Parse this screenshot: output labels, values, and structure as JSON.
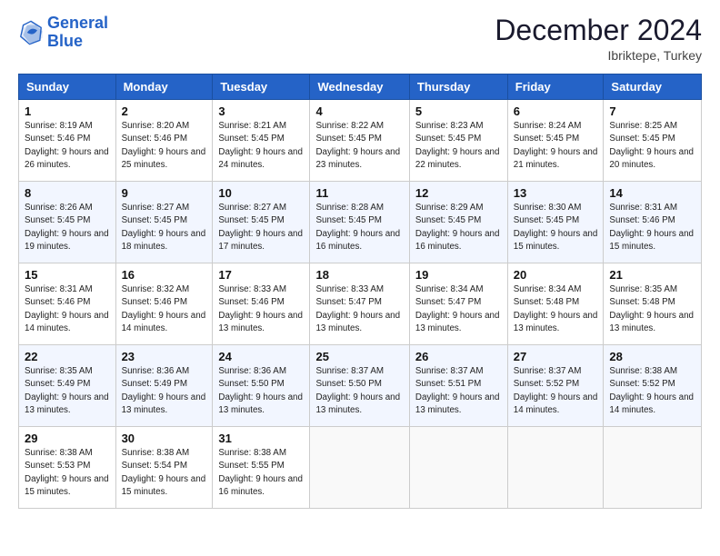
{
  "logo": {
    "line1": "General",
    "line2": "Blue"
  },
  "title": "December 2024",
  "location": "Ibriktepe, Turkey",
  "days_header": [
    "Sunday",
    "Monday",
    "Tuesday",
    "Wednesday",
    "Thursday",
    "Friday",
    "Saturday"
  ],
  "weeks": [
    [
      {
        "day": "1",
        "sunrise": "8:19 AM",
        "sunset": "5:46 PM",
        "daylight": "9 hours and 26 minutes."
      },
      {
        "day": "2",
        "sunrise": "8:20 AM",
        "sunset": "5:46 PM",
        "daylight": "9 hours and 25 minutes."
      },
      {
        "day": "3",
        "sunrise": "8:21 AM",
        "sunset": "5:45 PM",
        "daylight": "9 hours and 24 minutes."
      },
      {
        "day": "4",
        "sunrise": "8:22 AM",
        "sunset": "5:45 PM",
        "daylight": "9 hours and 23 minutes."
      },
      {
        "day": "5",
        "sunrise": "8:23 AM",
        "sunset": "5:45 PM",
        "daylight": "9 hours and 22 minutes."
      },
      {
        "day": "6",
        "sunrise": "8:24 AM",
        "sunset": "5:45 PM",
        "daylight": "9 hours and 21 minutes."
      },
      {
        "day": "7",
        "sunrise": "8:25 AM",
        "sunset": "5:45 PM",
        "daylight": "9 hours and 20 minutes."
      }
    ],
    [
      {
        "day": "8",
        "sunrise": "8:26 AM",
        "sunset": "5:45 PM",
        "daylight": "9 hours and 19 minutes."
      },
      {
        "day": "9",
        "sunrise": "8:27 AM",
        "sunset": "5:45 PM",
        "daylight": "9 hours and 18 minutes."
      },
      {
        "day": "10",
        "sunrise": "8:27 AM",
        "sunset": "5:45 PM",
        "daylight": "9 hours and 17 minutes."
      },
      {
        "day": "11",
        "sunrise": "8:28 AM",
        "sunset": "5:45 PM",
        "daylight": "9 hours and 16 minutes."
      },
      {
        "day": "12",
        "sunrise": "8:29 AM",
        "sunset": "5:45 PM",
        "daylight": "9 hours and 16 minutes."
      },
      {
        "day": "13",
        "sunrise": "8:30 AM",
        "sunset": "5:45 PM",
        "daylight": "9 hours and 15 minutes."
      },
      {
        "day": "14",
        "sunrise": "8:31 AM",
        "sunset": "5:46 PM",
        "daylight": "9 hours and 15 minutes."
      }
    ],
    [
      {
        "day": "15",
        "sunrise": "8:31 AM",
        "sunset": "5:46 PM",
        "daylight": "9 hours and 14 minutes."
      },
      {
        "day": "16",
        "sunrise": "8:32 AM",
        "sunset": "5:46 PM",
        "daylight": "9 hours and 14 minutes."
      },
      {
        "day": "17",
        "sunrise": "8:33 AM",
        "sunset": "5:46 PM",
        "daylight": "9 hours and 13 minutes."
      },
      {
        "day": "18",
        "sunrise": "8:33 AM",
        "sunset": "5:47 PM",
        "daylight": "9 hours and 13 minutes."
      },
      {
        "day": "19",
        "sunrise": "8:34 AM",
        "sunset": "5:47 PM",
        "daylight": "9 hours and 13 minutes."
      },
      {
        "day": "20",
        "sunrise": "8:34 AM",
        "sunset": "5:48 PM",
        "daylight": "9 hours and 13 minutes."
      },
      {
        "day": "21",
        "sunrise": "8:35 AM",
        "sunset": "5:48 PM",
        "daylight": "9 hours and 13 minutes."
      }
    ],
    [
      {
        "day": "22",
        "sunrise": "8:35 AM",
        "sunset": "5:49 PM",
        "daylight": "9 hours and 13 minutes."
      },
      {
        "day": "23",
        "sunrise": "8:36 AM",
        "sunset": "5:49 PM",
        "daylight": "9 hours and 13 minutes."
      },
      {
        "day": "24",
        "sunrise": "8:36 AM",
        "sunset": "5:50 PM",
        "daylight": "9 hours and 13 minutes."
      },
      {
        "day": "25",
        "sunrise": "8:37 AM",
        "sunset": "5:50 PM",
        "daylight": "9 hours and 13 minutes."
      },
      {
        "day": "26",
        "sunrise": "8:37 AM",
        "sunset": "5:51 PM",
        "daylight": "9 hours and 13 minutes."
      },
      {
        "day": "27",
        "sunrise": "8:37 AM",
        "sunset": "5:52 PM",
        "daylight": "9 hours and 14 minutes."
      },
      {
        "day": "28",
        "sunrise": "8:38 AM",
        "sunset": "5:52 PM",
        "daylight": "9 hours and 14 minutes."
      }
    ],
    [
      {
        "day": "29",
        "sunrise": "8:38 AM",
        "sunset": "5:53 PM",
        "daylight": "9 hours and 15 minutes."
      },
      {
        "day": "30",
        "sunrise": "8:38 AM",
        "sunset": "5:54 PM",
        "daylight": "9 hours and 15 minutes."
      },
      {
        "day": "31",
        "sunrise": "8:38 AM",
        "sunset": "5:55 PM",
        "daylight": "9 hours and 16 minutes."
      },
      null,
      null,
      null,
      null
    ]
  ],
  "labels": {
    "sunrise": "Sunrise:",
    "sunset": "Sunset:",
    "daylight": "Daylight:"
  }
}
